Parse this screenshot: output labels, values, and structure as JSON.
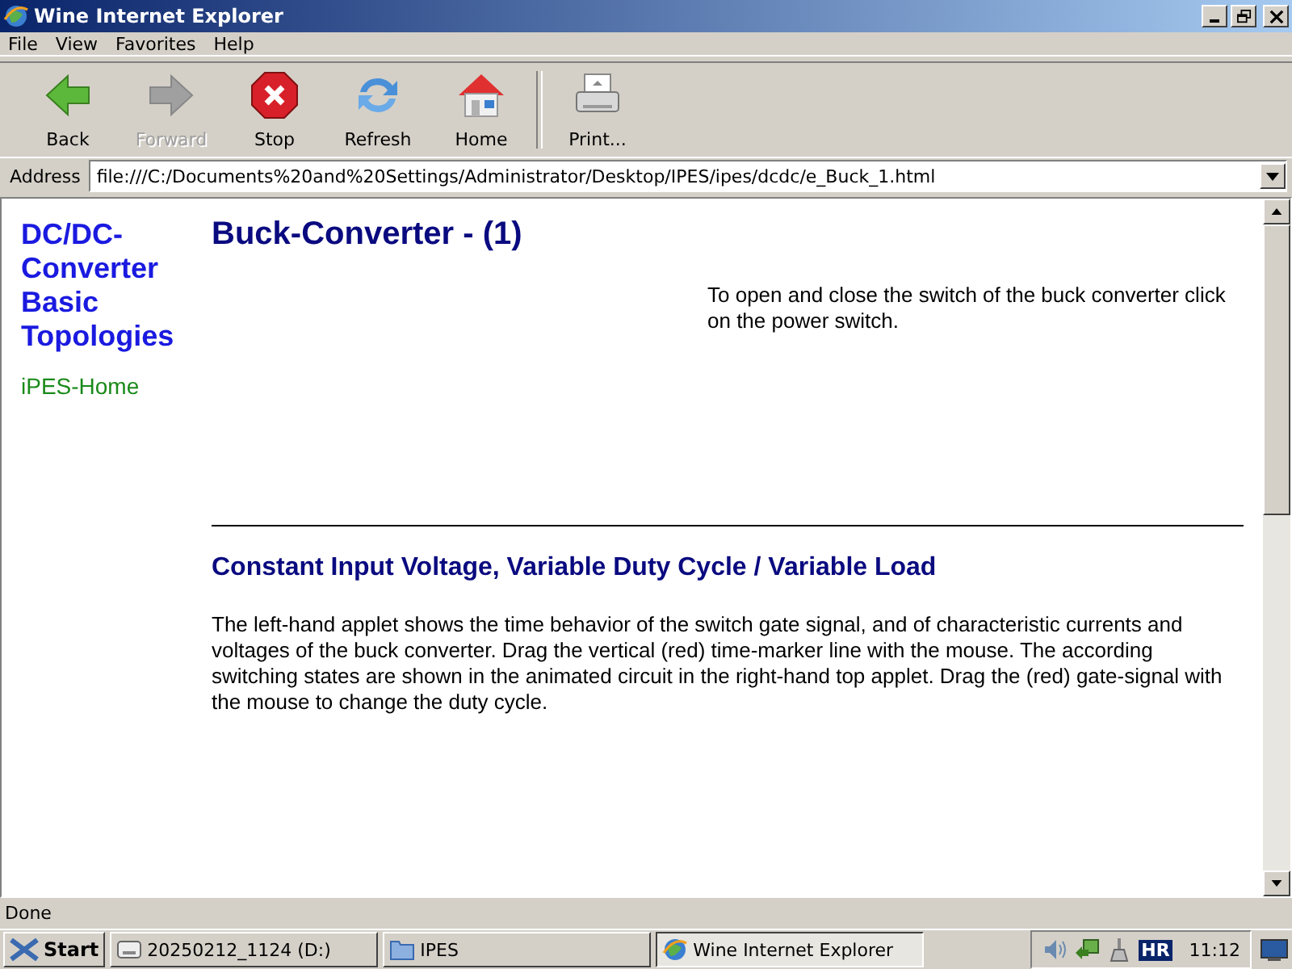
{
  "window": {
    "title": "Wine Internet Explorer"
  },
  "menu": [
    "File",
    "View",
    "Favorites",
    "Help"
  ],
  "toolbar": [
    {
      "label": "Back",
      "kind": "back",
      "disabled": false
    },
    {
      "label": "Forward",
      "kind": "forward",
      "disabled": true
    },
    {
      "label": "Stop",
      "kind": "stop",
      "disabled": false
    },
    {
      "label": "Refresh",
      "kind": "refresh",
      "disabled": false
    },
    {
      "label": "Home",
      "kind": "home",
      "disabled": false
    },
    {
      "label": "Print...",
      "kind": "print",
      "disabled": false
    }
  ],
  "address": {
    "label": "Address",
    "value": "file:///C:/Documents%20and%20Settings/Administrator/Desktop/IPES/ipes/dcdc/e_Buck_1.html"
  },
  "page": {
    "nav_title": "DC/DC-Converter Basic Topologies",
    "nav_link": "iPES-Home",
    "heading": "Buck-Converter - (1)",
    "instruction": "To open and close the switch of the buck converter click on the power switch.",
    "subheading": "Constant Input Voltage, Variable Duty Cycle / Variable Load",
    "paragraph": "The left-hand applet shows the time behavior of the switch gate signal, and of characteristic currents and voltages of the buck converter. Drag the vertical (red) time-marker line with the mouse. The according switching states are shown in the animated circuit in the right-hand top applet. Drag the (red) gate-signal with the mouse to change the duty cycle."
  },
  "status_bar": "Done",
  "taskbar": {
    "start": "Start",
    "tasks": [
      {
        "label": "20250212_1124 (D:)",
        "kind": "drive",
        "selected": false
      },
      {
        "label": "IPES",
        "kind": "folder",
        "selected": false
      },
      {
        "label": "Wine Internet Explorer",
        "kind": "browser",
        "selected": true
      }
    ],
    "language": "HR",
    "clock": "11:12"
  }
}
